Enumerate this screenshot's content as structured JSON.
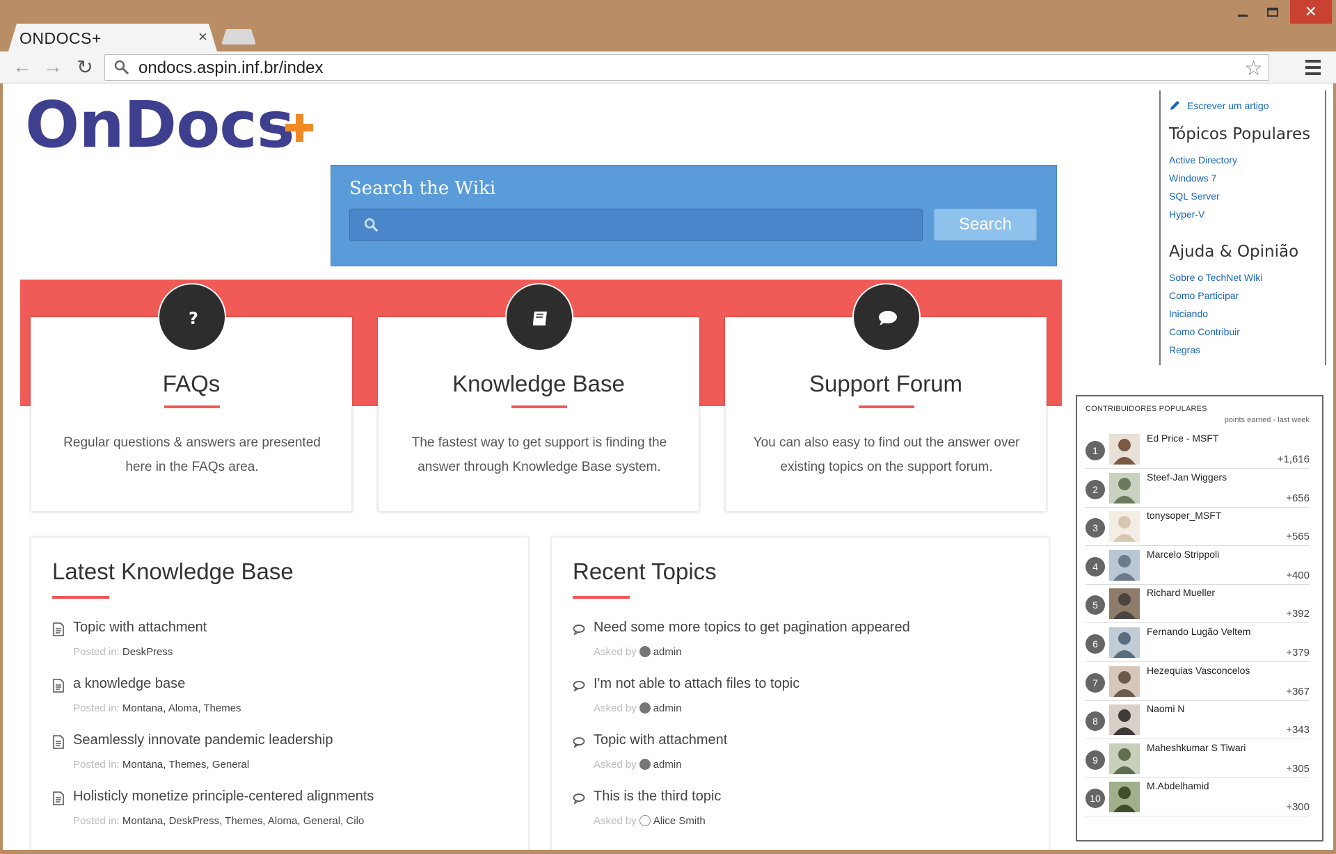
{
  "window": {
    "minimize": "minimize",
    "maximize": "maximize",
    "close": "✕"
  },
  "browser": {
    "tab_title": "ONDOCS+",
    "tab_close": "×",
    "url": "ondocs.aspin.inf.br/index",
    "back": "←",
    "forward": "→",
    "reload": "↻",
    "star": "☆"
  },
  "logo": {
    "text": "OnDocs"
  },
  "search": {
    "title": "Search the Wiki",
    "placeholder": "",
    "button": "Search"
  },
  "cards": [
    {
      "title": "FAQs",
      "text": "Regular questions & answers are presented here in the FAQs area.",
      "icon": "question-icon"
    },
    {
      "title": "Knowledge Base",
      "text": "The fastest way to get support is finding the answer through Knowledge Base system.",
      "icon": "book-icon"
    },
    {
      "title": "Support Forum",
      "text": "You can also easy to find out the answer over existing topics on the support forum.",
      "icon": "chat-bubble-icon"
    }
  ],
  "latest_kb": {
    "title": "Latest Knowledge Base",
    "items": [
      {
        "title": "Topic with attachment",
        "meta_label": "Posted in:",
        "meta": "DeskPress"
      },
      {
        "title": "a knowledge base",
        "meta_label": "Posted in:",
        "meta": "Montana, Aloma, Themes"
      },
      {
        "title": "Seamlessly innovate pandemic leadership",
        "meta_label": "Posted in:",
        "meta": "Montana, Themes, General"
      },
      {
        "title": "Holisticly monetize principle-centered alignments",
        "meta_label": "Posted in:",
        "meta": "Montana, DeskPress, Themes, Aloma, General, Cilo"
      }
    ]
  },
  "recent_topics": {
    "title": "Recent Topics",
    "items": [
      {
        "title": "Need some more topics to get pagination appeared",
        "meta_label": "Asked by",
        "meta": "admin"
      },
      {
        "title": "I'm not able to attach files to topic",
        "meta_label": "Asked by",
        "meta": "admin"
      },
      {
        "title": "Topic with attachment",
        "meta_label": "Asked by",
        "meta": "admin"
      },
      {
        "title": "This is the third topic",
        "meta_label": "Asked by",
        "meta": "Alice Smith"
      }
    ]
  },
  "sidebar": {
    "write": "Escrever um artigo",
    "popular_title": "Tópicos Populares",
    "popular": [
      "Active Directory",
      "Windows 7",
      "SQL Server",
      "Hyper-V"
    ],
    "help_title": "Ajuda & Opinião",
    "help": [
      "Sobre o TechNet Wiki",
      "Como Participar",
      "Iniciando",
      "Como Contribuir",
      "Regras"
    ]
  },
  "contributors": {
    "title": "CONTRIBUIDORES POPULARES",
    "subtitle": "points earned - last week",
    "list": [
      {
        "rank": "1",
        "name": "Ed Price - MSFT",
        "points": "+1,616"
      },
      {
        "rank": "2",
        "name": "Steef-Jan Wiggers",
        "points": "+656"
      },
      {
        "rank": "3",
        "name": "tonysoper_MSFT",
        "points": "+565"
      },
      {
        "rank": "4",
        "name": "Marcelo Strippoli",
        "points": "+400"
      },
      {
        "rank": "5",
        "name": "Richard Mueller",
        "points": "+392"
      },
      {
        "rank": "6",
        "name": "Fernando Lugão Veltem",
        "points": "+379"
      },
      {
        "rank": "7",
        "name": "Hezequias Vasconcelos",
        "points": "+367"
      },
      {
        "rank": "8",
        "name": "Naomi N",
        "points": "+343"
      },
      {
        "rank": "9",
        "name": "Maheshkumar S Tiwari",
        "points": "+305"
      },
      {
        "rank": "10",
        "name": "M.Abdelhamid",
        "points": "+300"
      }
    ]
  }
}
